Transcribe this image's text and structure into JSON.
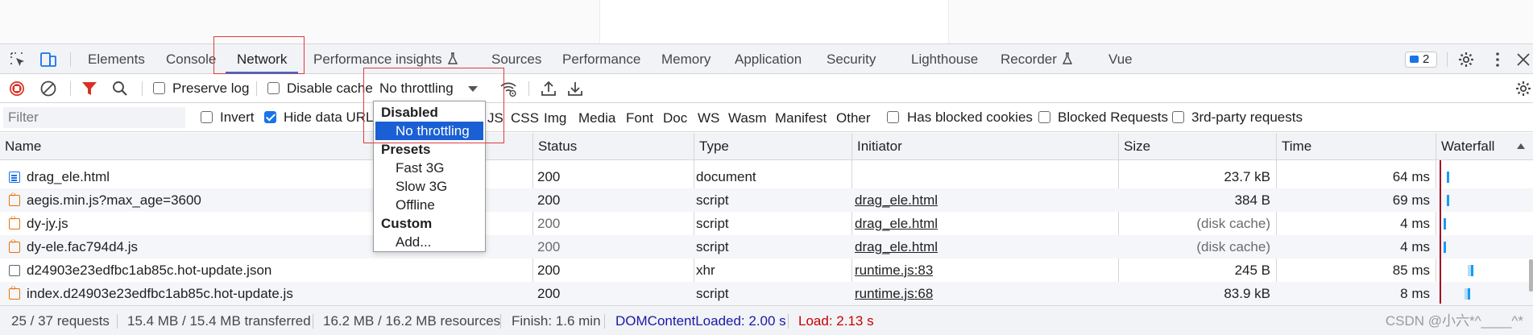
{
  "tabs": [
    {
      "label": "Elements"
    },
    {
      "label": "Console"
    },
    {
      "label": "Network"
    },
    {
      "label": "Performance insights"
    },
    {
      "label": "Sources"
    },
    {
      "label": "Performance"
    },
    {
      "label": "Memory"
    },
    {
      "label": "Application"
    },
    {
      "label": "Security"
    },
    {
      "label": "Lighthouse"
    },
    {
      "label": "Recorder"
    },
    {
      "label": "Vue"
    }
  ],
  "issues_count": "2",
  "toolbar": {
    "preserve_log": "Preserve log",
    "disable_cache": "Disable cache",
    "throttling_value": "No throttling"
  },
  "throttling_menu": {
    "group_disabled": "Disabled",
    "no_throttling": "No throttling",
    "group_presets": "Presets",
    "fast_3g": "Fast 3G",
    "slow_3g": "Slow 3G",
    "offline": "Offline",
    "group_custom": "Custom",
    "add": "Add..."
  },
  "filter": {
    "placeholder": "Filter",
    "invert": "Invert",
    "hide_data_urls": "Hide data URLs",
    "types": [
      "JS",
      "CSS",
      "Img",
      "Media",
      "Font",
      "Doc",
      "WS",
      "Wasm",
      "Manifest",
      "Other"
    ],
    "has_blocked_cookies": "Has blocked cookies",
    "blocked_requests": "Blocked Requests",
    "third_party": "3rd-party requests"
  },
  "columns": {
    "name": "Name",
    "status": "Status",
    "type": "Type",
    "initiator": "Initiator",
    "size": "Size",
    "time": "Time",
    "waterfall": "Waterfall"
  },
  "rows": [
    {
      "name": "drag_ele.html",
      "status": "200",
      "type": "document",
      "initiator": "",
      "size": "23.7 kB",
      "time": "64 ms",
      "icon": "doc"
    },
    {
      "name": "aegis.min.js?max_age=3600",
      "status": "200",
      "type": "script",
      "initiator": "drag_ele.html",
      "size": "384 B",
      "time": "69 ms",
      "icon": "script"
    },
    {
      "name": "dy-jy.js",
      "status": "200",
      "type": "script",
      "initiator": "drag_ele.html",
      "size": "(disk cache)",
      "time": "4 ms",
      "icon": "script"
    },
    {
      "name": "dy-ele.fac794d4.js",
      "status": "200",
      "type": "script",
      "initiator": "drag_ele.html",
      "size": "(disk cache)",
      "time": "4 ms",
      "icon": "script"
    },
    {
      "name": "d24903e23edfbc1ab85c.hot-update.json",
      "status": "200",
      "type": "xhr",
      "initiator": "runtime.js:83",
      "size": "245 B",
      "time": "85 ms",
      "icon": "xhr"
    },
    {
      "name": "index.d24903e23edfbc1ab85c.hot-update.js",
      "status": "200",
      "type": "script",
      "initiator": "runtime.js:68",
      "size": "83.9 kB",
      "time": "8 ms",
      "icon": "script"
    }
  ],
  "status_bar": {
    "requests": "25 / 37 requests",
    "transferred": "15.4 MB / 15.4 MB transferred",
    "resources": "16.2 MB / 16.2 MB resources",
    "finish": "Finish: 1.6 min",
    "dom_content_loaded": "DOMContentLoaded: 2.00 s",
    "load": "Load: 2.13 s"
  },
  "watermark": "CSDN @小六*^____^*",
  "colors": {
    "accent": "#1a73e8",
    "selected": "#1a5fd4",
    "annotation": "#e0393e",
    "dcl": "#1a1aa6",
    "load": "#c80000"
  }
}
